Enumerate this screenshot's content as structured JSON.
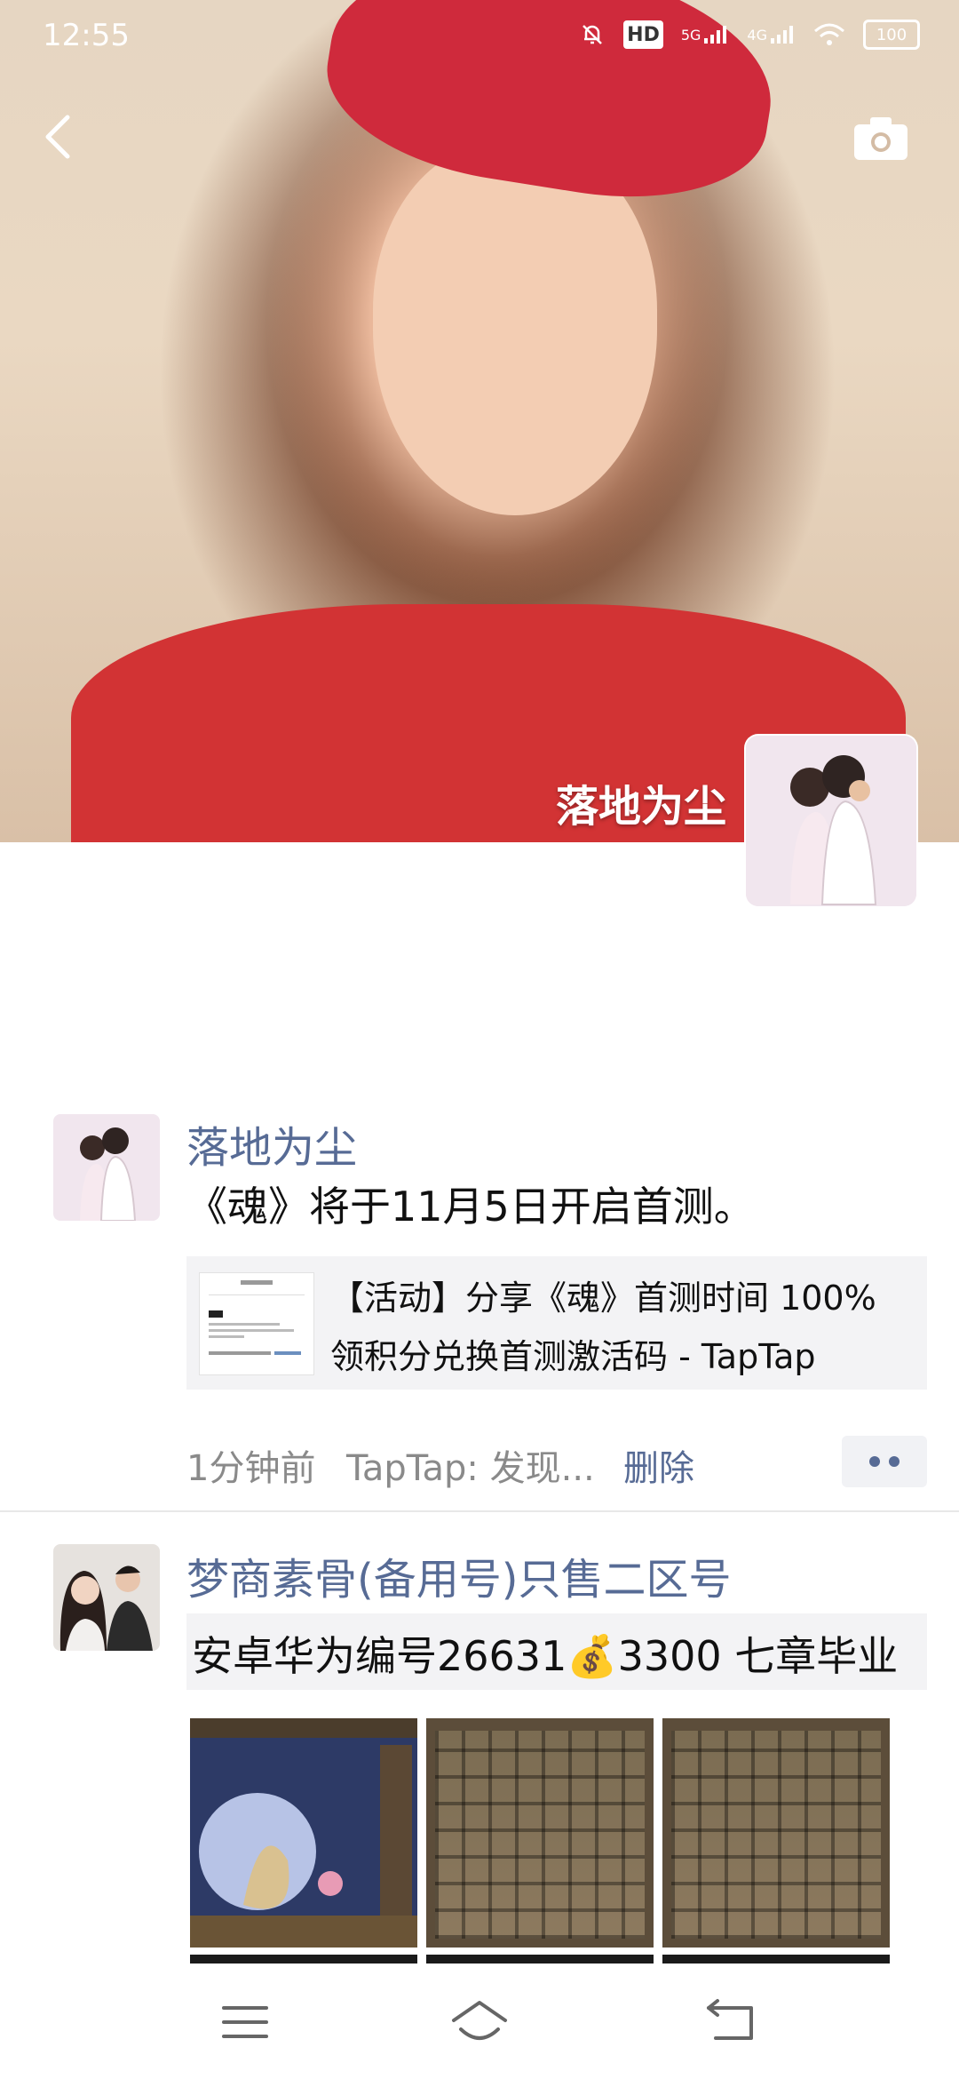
{
  "status_bar": {
    "time": "12:55",
    "indicators": [
      "mute-icon",
      "hd-icon",
      "5g-signal-icon",
      "4g-signal-icon",
      "wifi-icon"
    ],
    "hd_label": "HD",
    "net_5g": "5G",
    "net_4g": "4G",
    "battery": "100"
  },
  "profile": {
    "name": "落地为尘"
  },
  "posts": [
    {
      "author": "落地为尘",
      "text": "《魂》将于11月5日开启首测。",
      "share": {
        "title": "【活动】分享《魂》首测时间 100% 领积分兑换首测激活码 - TapTap"
      },
      "time": "1分钟前",
      "source": "TapTap: 发现...",
      "delete_label": "删除"
    },
    {
      "author": "梦商素骨(备用号)只售二区号",
      "text": "安卓华为编号26631💰3300 七章毕业"
    }
  ],
  "colors": {
    "link_blue": "#576b95",
    "meta_gray": "#8a8a8a",
    "card_bg": "#f3f3f5"
  }
}
